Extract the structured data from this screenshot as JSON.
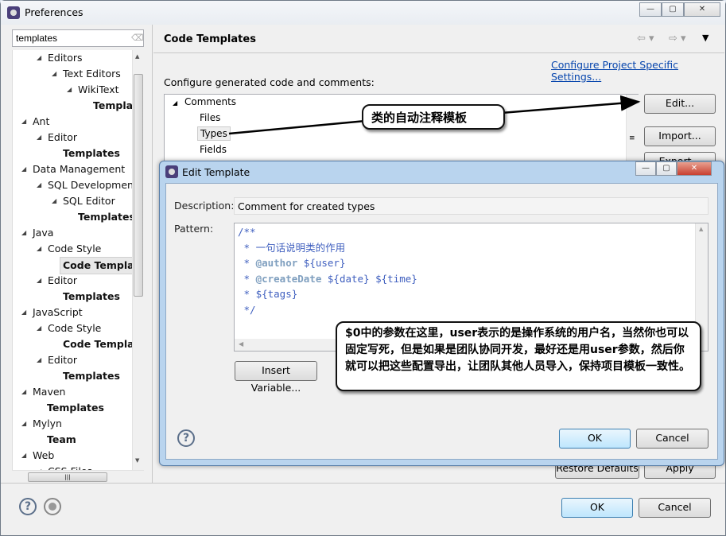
{
  "window": {
    "title": "Preferences",
    "min": "—",
    "max": "▢",
    "close": "✕"
  },
  "sidebar": {
    "search_value": "templates",
    "items": [
      {
        "label": "Editors",
        "level": 1,
        "bold": false
      },
      {
        "label": "Text Editors",
        "level": 2,
        "bold": false
      },
      {
        "label": "WikiText",
        "level": 3,
        "bold": false
      },
      {
        "label": "Templates",
        "level": 4,
        "bold": true
      },
      {
        "label": "Ant",
        "level": 0,
        "bold": false
      },
      {
        "label": "Editor",
        "level": 1,
        "bold": false
      },
      {
        "label": "Templates",
        "level": 2,
        "bold": true
      },
      {
        "label": "Data Management",
        "level": 0,
        "bold": false
      },
      {
        "label": "SQL Development",
        "level": 1,
        "bold": false
      },
      {
        "label": "SQL Editor",
        "level": 2,
        "bold": false
      },
      {
        "label": "Templates",
        "level": 3,
        "bold": true
      },
      {
        "label": "Java",
        "level": 0,
        "bold": false
      },
      {
        "label": "Code Style",
        "level": 1,
        "bold": false
      },
      {
        "label": "Code Templates",
        "level": 2,
        "bold": true,
        "selected": true
      },
      {
        "label": "Editor",
        "level": 1,
        "bold": false
      },
      {
        "label": "Templates",
        "level": 2,
        "bold": true
      },
      {
        "label": "JavaScript",
        "level": 0,
        "bold": false
      },
      {
        "label": "Code Style",
        "level": 1,
        "bold": false
      },
      {
        "label": "Code Templates",
        "level": 2,
        "bold": true
      },
      {
        "label": "Editor",
        "level": 1,
        "bold": false
      },
      {
        "label": "Templates",
        "level": 2,
        "bold": true
      },
      {
        "label": "Maven",
        "level": 0,
        "bold": false
      },
      {
        "label": "Templates",
        "level": 1,
        "bold": true
      },
      {
        "label": "Mylyn",
        "level": 0,
        "bold": false
      },
      {
        "label": "Team",
        "level": 1,
        "bold": true
      },
      {
        "label": "Web",
        "level": 0,
        "bold": false
      },
      {
        "label": "CSS Files",
        "level": 1,
        "bold": false
      }
    ]
  },
  "main": {
    "title": "Code Templates",
    "configure_link": "Configure Project Specific Settings...",
    "description": "Configure generated code and comments:",
    "tree": {
      "root": "Comments",
      "children": [
        "Files",
        "Types",
        "Fields"
      ],
      "selected": "Types"
    },
    "buttons": {
      "edit": "Edit...",
      "import": "Import...",
      "export": "Export...",
      "restore": "Restore Defaults",
      "apply": "Apply",
      "ok": "OK",
      "cancel": "Cancel"
    }
  },
  "dialog": {
    "title": "Edit Template",
    "description_label": "Description:",
    "description_value": "Comment for created types",
    "pattern_label": "Pattern:",
    "pattern_lines": [
      {
        "prefix": "/**",
        "tag": "",
        "rest": ""
      },
      {
        "prefix": " * 一句话说明类的作用",
        "tag": "",
        "rest": ""
      },
      {
        "prefix": " * ",
        "tag": "@author",
        "rest": " ${user}"
      },
      {
        "prefix": " * ",
        "tag": "@createDate",
        "rest": " ${date} ${time}"
      },
      {
        "prefix": " * ${tags}",
        "tag": "",
        "rest": ""
      },
      {
        "prefix": " */",
        "tag": "",
        "rest": ""
      }
    ],
    "insert_variable": "Insert Variable...",
    "ok": "OK",
    "cancel": "Cancel"
  },
  "callouts": {
    "types_note": "类的自动注释模板",
    "params_note": "$0中的参数在这里，user表示的是操作系统的用户名，当然你也可以固定写死，但是如果是团队协同开发，最好还是用user参数，然后你就可以把这些配置导出，让团队其他人员导入，保持项目模板一致性。"
  }
}
